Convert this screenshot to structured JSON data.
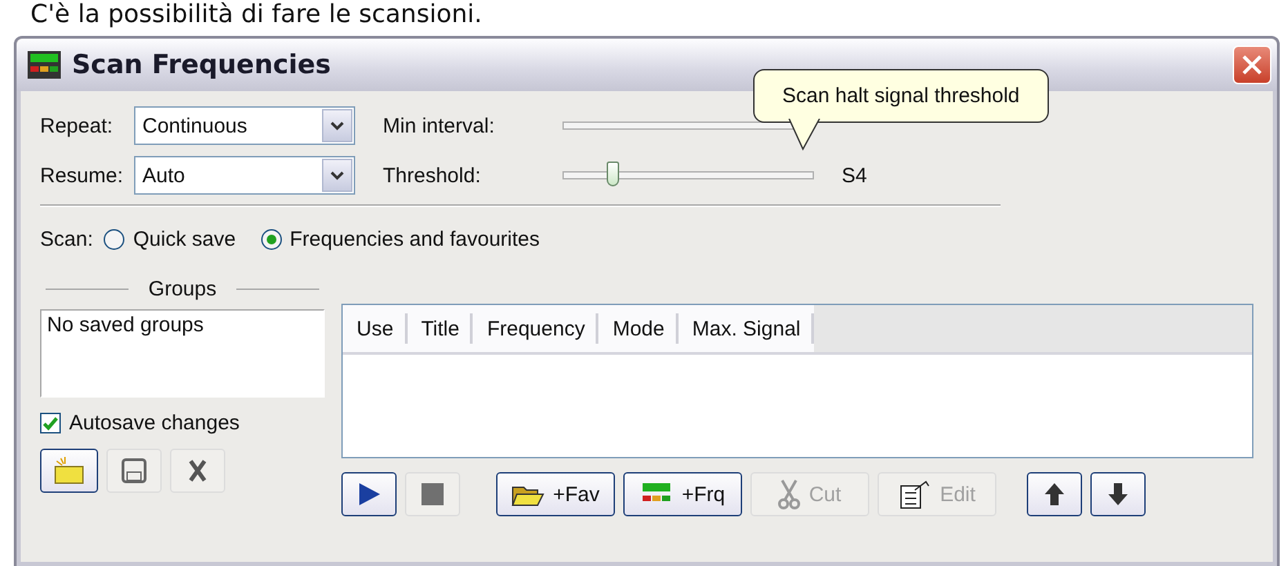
{
  "caption": "C'è la possibilità di fare le scansioni.",
  "window": {
    "title": "Scan Frequencies"
  },
  "dropdowns": [
    {
      "label": "Repeat:",
      "value": "Continuous"
    },
    {
      "label": "Resume:",
      "value": "Auto"
    }
  ],
  "sliders": [
    {
      "label": "Min interval:"
    },
    {
      "label": "Threshold:",
      "level": 0.2,
      "reading": "S4"
    }
  ],
  "tooltip": "Scan halt signal threshold",
  "scan": {
    "label": "Scan:",
    "options": [
      {
        "label": "Quick save",
        "selected": false
      },
      {
        "label": "Frequencies and favourites",
        "selected": true
      }
    ]
  },
  "groups": {
    "title": "Groups",
    "items": [
      "No saved groups"
    ],
    "autosave": {
      "label": "Autosave changes",
      "checked": true
    }
  },
  "table": {
    "columns": [
      "Use",
      "Title",
      "Frequency",
      "Mode",
      "Max. Signal"
    ]
  },
  "group_buttons": [
    {
      "kind": "new",
      "disabled": false
    },
    {
      "kind": "save",
      "disabled": true
    },
    {
      "kind": "delete",
      "disabled": true
    }
  ],
  "toolbar": [
    {
      "kind": "play",
      "disabled": false
    },
    {
      "kind": "stop",
      "disabled": true
    },
    {
      "kind": "fav",
      "label": "+Fav",
      "disabled": false
    },
    {
      "kind": "frq",
      "label": "+Frq",
      "disabled": false
    },
    {
      "kind": "cut",
      "label": "Cut",
      "disabled": true
    },
    {
      "kind": "edit",
      "label": "Edit",
      "disabled": true
    },
    {
      "kind": "up",
      "disabled": false
    },
    {
      "kind": "down",
      "disabled": false
    }
  ]
}
